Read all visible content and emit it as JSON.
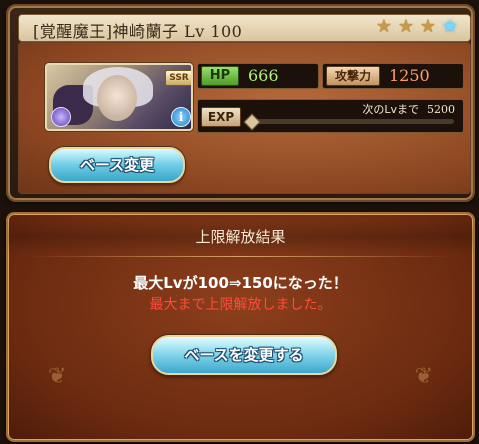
{
  "character": {
    "name": "[覚醒魔王]神崎蘭子 Lv 100",
    "rarity_badge": "SSR",
    "stars": [
      {
        "type": "gold",
        "icon": "star-gold-icon"
      },
      {
        "type": "gold",
        "icon": "star-gold-icon"
      },
      {
        "type": "gold",
        "icon": "star-gold-icon"
      },
      {
        "type": "blue",
        "icon": "star-blue-icon"
      }
    ],
    "info_glyph": "i",
    "base_change_label": "ベース変更"
  },
  "stats": {
    "hp_label": "HP",
    "hp_value": "666",
    "atk_label": "攻撃力",
    "atk_value": "1250",
    "exp_label": "EXP",
    "next_lv_label": "次のLvまで",
    "next_lv_value": "5200",
    "exp_progress": 0.0
  },
  "dialog": {
    "title": "上限解放結果",
    "message_main": "最大Lvが100⇒150になった！",
    "message_sub": "最大まで上限解放しました。",
    "button_label": "ベースを変更する"
  },
  "colors": {
    "hp_value": "#b4f07c",
    "atk_value": "#ff9e6b",
    "warning_text": "#ff4c3a",
    "button_blue": "#6fcde6"
  }
}
